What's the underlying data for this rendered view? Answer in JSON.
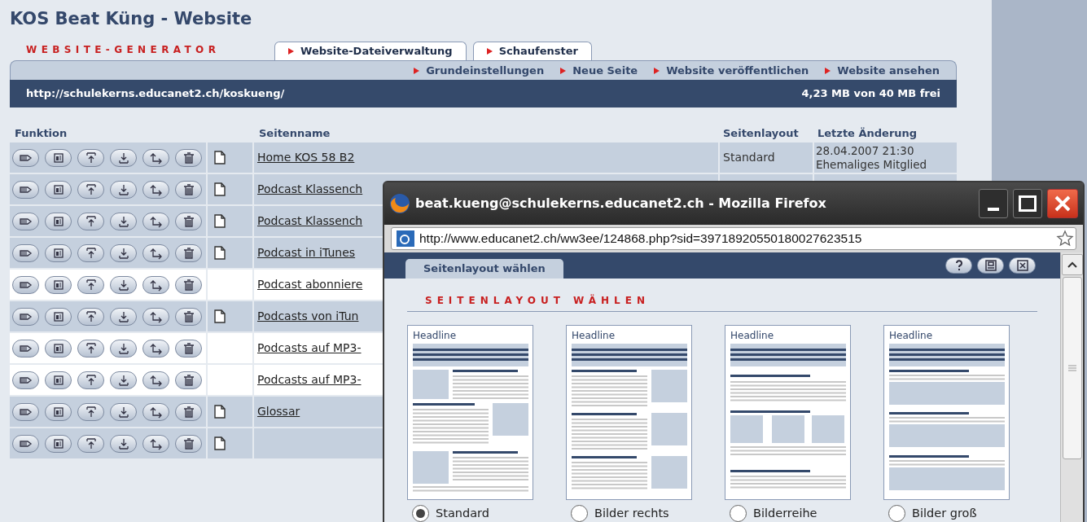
{
  "page_title": "KOS Beat Küng - Website",
  "brand": "WEBSITE-GENERATOR",
  "tabs": [
    {
      "label": "Website-Dateiverwaltung"
    },
    {
      "label": "Schaufenster"
    }
  ],
  "subnav": [
    "Grundeinstellungen",
    "Neue Seite",
    "Website veröffentlichen",
    "Website ansehen"
  ],
  "site_bar": {
    "url": "http://schulekerns.educanet2.ch/koskueng/",
    "quota": "4,23 MB von 40 MB frei"
  },
  "table": {
    "columns": [
      "Funktion",
      "Seitenname",
      "Seitenlayout",
      "Letzte Änderung"
    ],
    "rows": [
      {
        "name": "Home KOS 58 B2",
        "page_icon": true,
        "layout": "Standard",
        "changed": "28.04.2007 21:30",
        "changed_by": "Ehemaliges Mitglied"
      },
      {
        "name": "Podcast Klassench",
        "page_icon": true
      },
      {
        "name": "Podcast Klassench",
        "page_icon": true
      },
      {
        "name": "Podcast in iTunes",
        "page_icon": true
      },
      {
        "name": "Podcast abonniere",
        "page_icon": false
      },
      {
        "name": "Podcasts von iTun",
        "page_icon": true
      },
      {
        "name": "Podcasts auf MP3-",
        "page_icon": false
      },
      {
        "name": "Podcasts auf MP3-",
        "page_icon": false
      },
      {
        "name": "Glossar",
        "page_icon": true
      },
      {
        "name": "",
        "page_icon": true
      }
    ]
  },
  "popup": {
    "title": "beat.kueng@schulekerns.educanet2.ch - Mozilla Firefox",
    "address": "http://www.educanet2.ch/ww3ee/124868.php?sid=39718920550180027623515",
    "tab": "Seitenlayout wählen",
    "heading": "SEITENLAYOUT WÄHLEN",
    "layouts": [
      {
        "kind": "standard",
        "headline": "Headline",
        "label": "Standard",
        "selected": true
      },
      {
        "kind": "right",
        "headline": "Headline",
        "label": "Bilder rechts",
        "selected": false
      },
      {
        "kind": "row",
        "headline": "Headline",
        "label": "Bilderreihe",
        "selected": false
      },
      {
        "kind": "large",
        "headline": "Headline",
        "label": "Bilder groß",
        "selected": false
      }
    ]
  }
}
